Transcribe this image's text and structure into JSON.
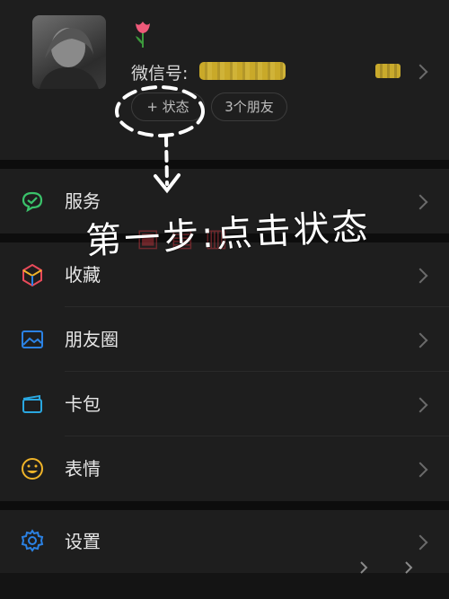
{
  "profile": {
    "wxid_label": "微信号:",
    "status_button": "+ 状态",
    "friends_button": "3个朋友"
  },
  "menu": {
    "services": "服务",
    "favorites": "收藏",
    "moments": "朋友圈",
    "cards": "卡包",
    "stickers": "表情",
    "settings": "设置"
  },
  "annotation": {
    "text": "第一步:点击状态"
  },
  "colors": {
    "background": "#1b1b1b",
    "services_icon": "#3ac26a",
    "favorites_icon": "#e84a5a",
    "moments_icon": "#2b82e4",
    "cards_icon": "#2aa7e0",
    "stickers_icon": "#f0b429",
    "settings_icon": "#2b82e4"
  },
  "icons": [
    "tulip-emoji-icon",
    "chevron-right-icon",
    "services-icon",
    "favorites-icon",
    "moments-icon",
    "card-icon",
    "sticker-icon",
    "gear-icon"
  ]
}
